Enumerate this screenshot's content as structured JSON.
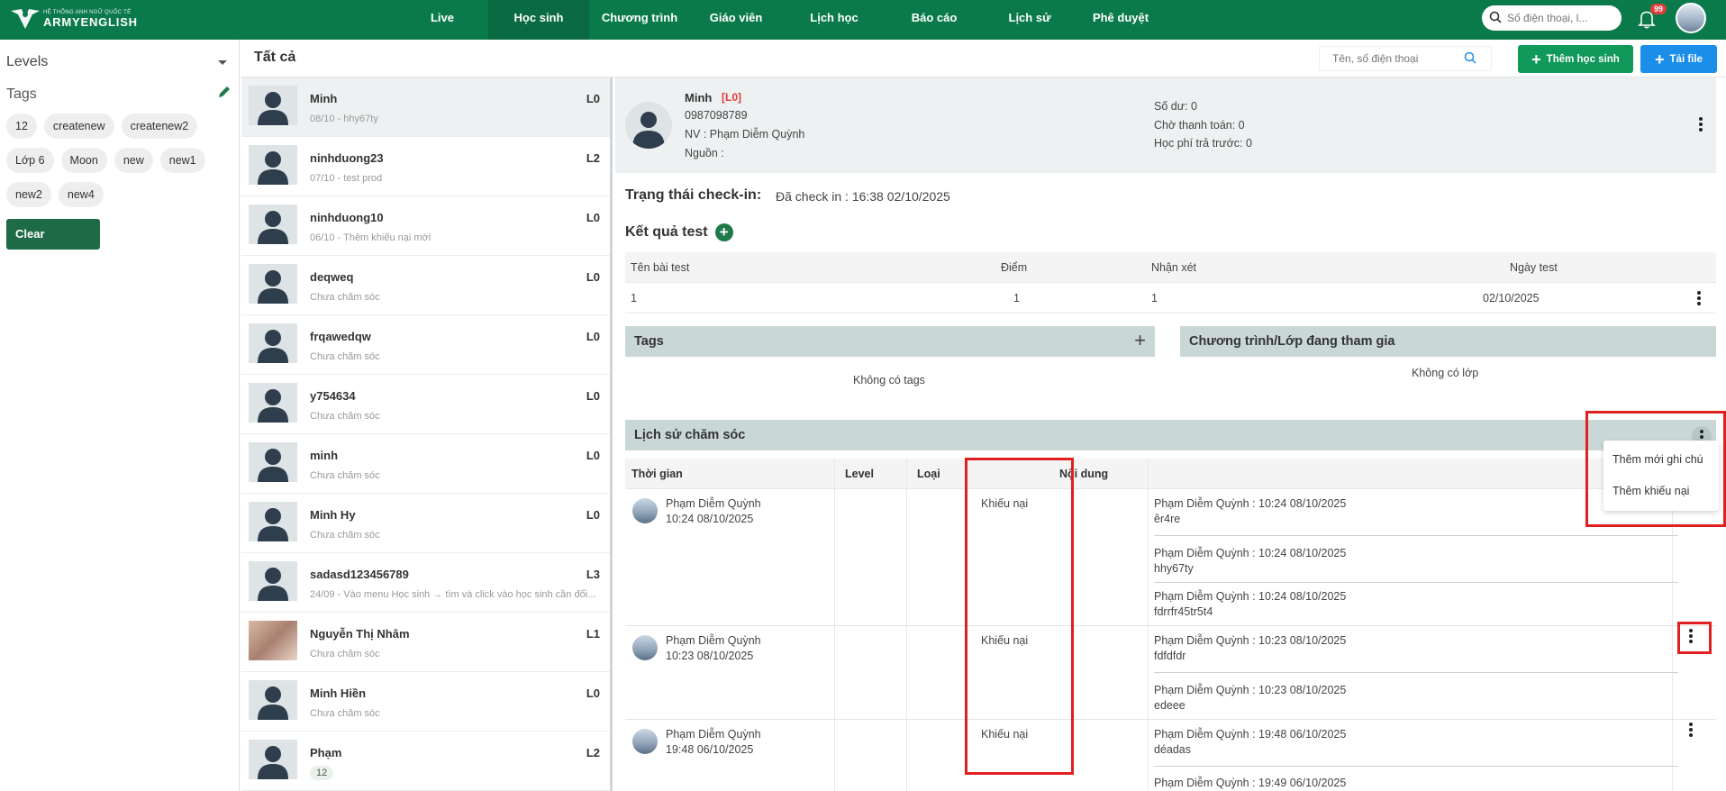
{
  "brand": {
    "subtitle": "HỆ THỐNG ANH NGỮ QUỐC TẾ",
    "name": "ARMYENGLISH"
  },
  "nav": {
    "items": [
      {
        "label": "Live",
        "active": false
      },
      {
        "label": "Học sinh",
        "active": true
      },
      {
        "label": "Chương trình",
        "active": false
      },
      {
        "label": "Giáo viên",
        "active": false
      },
      {
        "label": "Lịch học",
        "active": false
      },
      {
        "label": "Báo cáo",
        "active": false
      },
      {
        "label": "Lịch sử",
        "active": false
      },
      {
        "label": "Phê duyệt",
        "active": false
      }
    ],
    "search_placeholder": "Số điện thoại, l...",
    "notification_count": "99"
  },
  "filters": {
    "levels_label": "Levels",
    "tags_label": "Tags",
    "tags": [
      "12",
      "createnew",
      "createnew2",
      "Lớp 6",
      "Moon",
      "new",
      "new1",
      "new2",
      "new4"
    ],
    "clear_label": "Clear"
  },
  "subheader": {
    "title": "Tất cả",
    "search_placeholder": "Tên, số điện thoại",
    "add_student_label": "Thêm học sinh",
    "upload_label": "Tải file"
  },
  "students": [
    {
      "name": "Minh",
      "sub": "08/10 - hhy67ty",
      "level": "L0"
    },
    {
      "name": "ninhduong23",
      "sub": "07/10 - test prod",
      "level": "L2"
    },
    {
      "name": "ninhduong10",
      "sub": "06/10 - Thêm khiếu nại mới",
      "level": "L0"
    },
    {
      "name": "deqweq",
      "sub": "Chưa chăm sóc",
      "level": "L0"
    },
    {
      "name": "frqawedqw",
      "sub": "Chưa chăm sóc",
      "level": "L0"
    },
    {
      "name": "y754634",
      "sub": "Chưa chăm sóc",
      "level": "L0"
    },
    {
      "name": "minh",
      "sub": "Chưa chăm sóc",
      "level": "L0"
    },
    {
      "name": "Minh Hy",
      "sub": "Chưa chăm sóc",
      "level": "L0"
    },
    {
      "name": "sadasd123456789",
      "sub": "24/09 - Vào menu Học sinh → tìm và click vào học sinh cần đổi...",
      "level": "L3"
    },
    {
      "name": "Nguyễn Thị Nhâm",
      "sub": "Chưa chăm sóc",
      "level": "L1"
    },
    {
      "name": "Minh Hiền",
      "sub": "Chưa chăm sóc",
      "level": "L0"
    },
    {
      "name": "Phạm",
      "sub": "12",
      "level": "L2"
    }
  ],
  "profile": {
    "name": "Minh",
    "level": "[L0]",
    "phone": "0987098789",
    "staff": "NV : Phạm Diễm Quỳnh",
    "source": "Nguồn :",
    "balance": "Số dư: 0",
    "pending": "Chờ thanh toán: 0",
    "prepaid": "Học phí trả trước: 0"
  },
  "checkin": {
    "label": "Trạng thái check-in:",
    "value": "Đã check in : 16:38 02/10/2025"
  },
  "tests": {
    "title": "Kết quả test",
    "headers": [
      "Tên bài test",
      "Điểm",
      "Nhận xét",
      "Ngày test"
    ],
    "rows": [
      [
        "1",
        "1",
        "1",
        "02/10/2025"
      ]
    ]
  },
  "tags_section": {
    "title": "Tags",
    "empty": "Không có tags"
  },
  "classes_section": {
    "title": "Chương trình/Lớp đang tham gia",
    "empty": "Không có lớp"
  },
  "history": {
    "title": "Lịch sử chăm sóc",
    "headers": [
      "Thời gian",
      "Level",
      "Loại",
      "Nội dung"
    ],
    "menu": [
      "Thêm mới ghi chú",
      "Thêm khiếu nại"
    ],
    "rows": [
      {
        "who": "Phạm Diễm Quỳnh",
        "time": "10:24 08/10/2025",
        "type": "Khiếu nại",
        "entries": [
          {
            "head": "Phạm Diễm Quỳnh : 10:24 08/10/2025",
            "body": "êr4re"
          },
          {
            "head": "Phạm Diễm Quỳnh : 10:24 08/10/2025",
            "body": "hhy67ty"
          },
          {
            "head": "Phạm Diễm Quỳnh : 10:24 08/10/2025",
            "body": "fdrrfr45tr5t4"
          }
        ]
      },
      {
        "who": "Phạm Diễm Quỳnh",
        "time": "10:23 08/10/2025",
        "type": "Khiếu nại",
        "entries": [
          {
            "head": "Phạm Diễm Quỳnh : 10:23 08/10/2025",
            "body": "fdfdfdr"
          },
          {
            "head": "Phạm Diễm Quỳnh : 10:23 08/10/2025",
            "body": "edeee"
          }
        ]
      },
      {
        "who": "Phạm Diễm Quỳnh",
        "time": "19:48 06/10/2025",
        "type": "Khiếu nại",
        "entries": [
          {
            "head": "Phạm Diễm Quỳnh : 19:48 06/10/2025",
            "body": "déadas"
          },
          {
            "head": "Phạm Diễm Quỳnh : 19:49 06/10/2025",
            "body": ""
          }
        ]
      }
    ]
  }
}
